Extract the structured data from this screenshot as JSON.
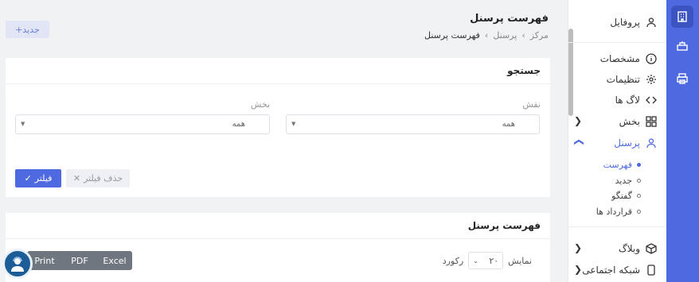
{
  "rail": {
    "icons": [
      "building-icon",
      "toolbox-icon",
      "printer-icon"
    ]
  },
  "sidebar": {
    "profile": "پروفایل",
    "specs": "مشخصات",
    "settings": "تنظیمات",
    "logs": "لاگ ها",
    "section": "بخش",
    "personnel": "پرسنل",
    "sub": [
      "فهرست",
      "جدید",
      "گفتگو",
      "قرارداد ها"
    ],
    "blog": "وبلاگ",
    "social": "شبکه اجتماعی"
  },
  "header": {
    "title": "فهرست پرسنل",
    "breadcrumb": [
      "مرکز",
      "پرسنل",
      "فهرست پرسنل"
    ],
    "new_button": "+جدید"
  },
  "search": {
    "title": "جستجو",
    "role_label": "نقش",
    "role_value": "همه",
    "section_label": "بخش",
    "section_value": "همه",
    "filter_button": "فیلتر",
    "clear_button": "حذف فیلتر"
  },
  "list": {
    "title": "فهرست پرسنل",
    "show_label": "نمایش",
    "page_size": "۲۰",
    "records_label": "رکورد",
    "export": [
      "Print",
      "PDF",
      "Excel"
    ]
  }
}
